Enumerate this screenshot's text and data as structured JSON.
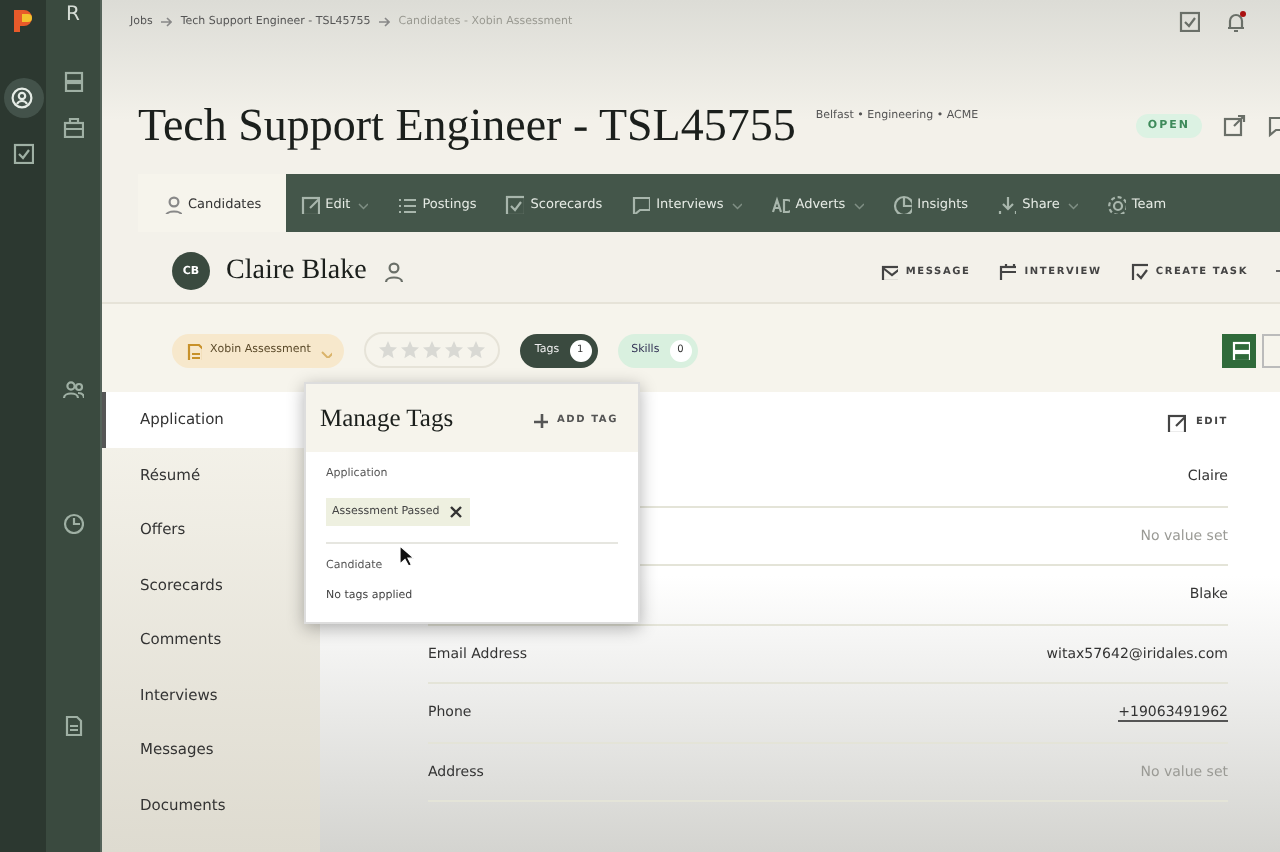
{
  "rail": {
    "workspace_letter": "R"
  },
  "breadcrumb": [
    "Jobs",
    "Tech Support Engineer - TSL45755",
    "Candidates - Xobin Assessment"
  ],
  "job": {
    "title": "Tech Support Engineer - TSL45755",
    "meta": "Belfast • Engineering • ACME",
    "status": "OPEN"
  },
  "tabs": [
    {
      "label": "Candidates",
      "selected": true,
      "dropdown": false
    },
    {
      "label": "Edit",
      "selected": false,
      "dropdown": true
    },
    {
      "label": "Postings",
      "selected": false,
      "dropdown": false
    },
    {
      "label": "Scorecards",
      "selected": false,
      "dropdown": false
    },
    {
      "label": "Interviews",
      "selected": false,
      "dropdown": true
    },
    {
      "label": "Adverts",
      "selected": false,
      "dropdown": true
    },
    {
      "label": "Insights",
      "selected": false,
      "dropdown": false
    },
    {
      "label": "Share",
      "selected": false,
      "dropdown": true
    },
    {
      "label": "Team",
      "selected": false,
      "dropdown": false
    }
  ],
  "candidate": {
    "initials": "CB",
    "name": "Claire Blake",
    "actions": [
      "MESSAGE",
      "INTERVIEW",
      "CREATE TASK"
    ]
  },
  "stage": {
    "label": "Xobin Assessment",
    "stars": 0
  },
  "chips": [
    {
      "label": "Tags",
      "count": "1",
      "selected": true
    },
    {
      "label": "Skills",
      "count": "0",
      "selected": false
    }
  ],
  "sections": [
    {
      "label": "Application",
      "selected": true
    },
    {
      "label": "Résumé",
      "selected": false
    },
    {
      "label": "Offers",
      "selected": false
    },
    {
      "label": "Scorecards",
      "selected": false
    },
    {
      "label": "Comments",
      "selected": false
    },
    {
      "label": "Interviews",
      "selected": false
    },
    {
      "label": "Messages",
      "selected": false
    },
    {
      "label": "Documents",
      "selected": false
    }
  ],
  "edit_label": "EDIT",
  "fields": [
    {
      "value": "Claire",
      "kind": "text"
    },
    {
      "value": "No value set",
      "kind": "empty"
    },
    {
      "value": "Blake",
      "kind": "text"
    },
    {
      "label": "Email Address",
      "value": "witax57642@iridales.com",
      "kind": "text"
    },
    {
      "label": "Phone",
      "value": "+19063491962",
      "kind": "link"
    },
    {
      "label": "Address",
      "value": "No value set",
      "kind": "empty"
    }
  ],
  "tags_popup": {
    "title": "Manage Tags",
    "add": "ADD TAG",
    "groups": [
      {
        "name": "Application",
        "tags": [
          "Assessment Passed"
        ]
      },
      {
        "name": "Candidate",
        "empty": "No tags applied"
      }
    ]
  }
}
